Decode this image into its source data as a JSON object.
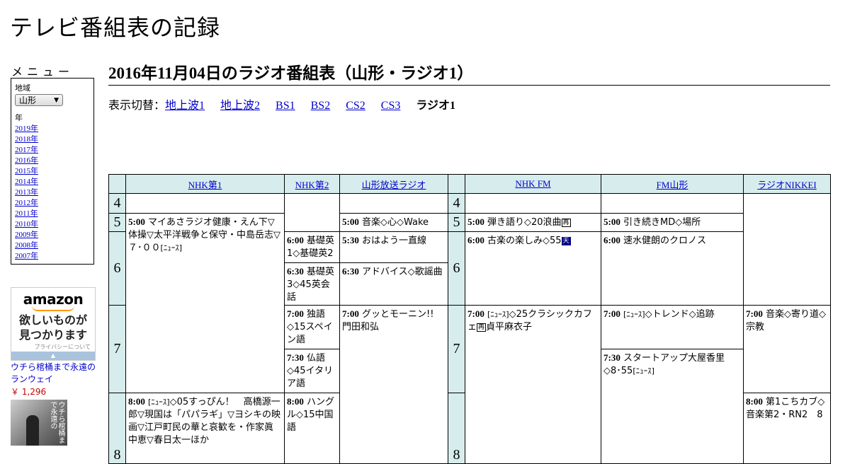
{
  "site": {
    "title": "テレビ番組表の記録"
  },
  "menu": {
    "label": "メニュー",
    "region_label": "地域",
    "region_value": "山形",
    "year_label": "年",
    "years": [
      "2019年",
      "2018年",
      "2017年",
      "2016年",
      "2015年",
      "2014年",
      "2013年",
      "2012年",
      "2011年",
      "2010年",
      "2009年",
      "2008年",
      "2007年"
    ]
  },
  "ad": {
    "logo": "amazon",
    "slogan_1": "欲しいものが",
    "slogan_2": "見つかります",
    "privacy": "プライバシーについて",
    "book_title": "ウチら棺桶まで永遠のランウェイ",
    "book_price": "￥ 1,296",
    "cover_text": "ウチら棺桶まで永遠の"
  },
  "page": {
    "title": "2016年11月04日のラジオ番組表（山形・ラジオ1）",
    "switch_label": "表示切替：",
    "switch_links": [
      "地上波1",
      "地上波2",
      "BS1",
      "BS2",
      "CS2",
      "CS3"
    ],
    "switch_current": "ラジオ1"
  },
  "schedule": {
    "channels": [
      "NHK第1",
      "NHK第2",
      "山形放送ラジオ",
      "NHK FM",
      "FM山形",
      "ラジオNIKKEI"
    ],
    "hours": [
      "4",
      "5",
      "6",
      "7",
      "8"
    ],
    "programs": {
      "nhk1_500_time": "5:00",
      "nhk1_500_text": "マイあさラジオ健康・えん下▽体操▽太平洋戦争と保守・中島岳志▽７･００",
      "nhk1_500_news": "[ﾆｭｰｽ]",
      "nhk1_800_time": "8:00",
      "nhk1_800_news": "[ﾆｭｰｽ]",
      "nhk1_800_text": "◇05すっぴん！　高橋源一郎▽現国は「パパラギ」▽ヨシキの映画▽江戸町民の華と哀歓を・作家眞中恵▽春日太一ほか",
      "nhk2_600_time": "6:00",
      "nhk2_600_text": "基礎英1◇基礎英2",
      "nhk2_630_time": "6:30",
      "nhk2_630_text": "基礎英3◇45英会話",
      "nhk2_700_time": "7:00",
      "nhk2_700_text": "独語◇15スペイン語",
      "nhk2_730_time": "7:30",
      "nhk2_730_text": "仏語◇45イタリア語",
      "nhk2_800_time": "8:00",
      "nhk2_800_text": "ハングル◇15中国語",
      "ybc_500_time": "5:00",
      "ybc_500_text": "音楽◇心◇Wake",
      "ybc_530_time": "5:30",
      "ybc_530_text": "おはよう一直線",
      "ybc_630_time": "6:30",
      "ybc_630_text": "アドバイス◇歌謡曲",
      "ybc_700_time": "7:00",
      "ybc_700_text": "グッとモーニン!!　門田和弘",
      "fm_500_time": "5:00",
      "fm_500_text": "弾き語り◇20浪曲",
      "fm_500_mark": "再",
      "fm_600_time": "6:00",
      "fm_600_text": "古楽の楽しみ◇55",
      "fm_600_mark": "天",
      "fm_700_time": "7:00",
      "fm_700_news": "[ﾆｭｰｽ]",
      "fm_700_text": "◇25クラシックカフェ",
      "fm_700_mark": "再",
      "fm_700_text2": "貞平麻衣子",
      "fmy_500_time": "5:00",
      "fmy_500_text": "引き続きMD◇場所",
      "fmy_600_time": "6:00",
      "fmy_600_text": "速水健朗のクロノス",
      "fmy_700_time": "7:00",
      "fmy_700_news": "[ﾆｭｰｽ]",
      "fmy_700_text": "◇トレンド◇追跡",
      "fmy_730_time": "7:30",
      "fmy_730_text": "スタートアップ大屋香里◇8･55",
      "fmy_730_news": "[ﾆｭｰｽ]",
      "nikkei_700_time": "7:00",
      "nikkei_700_text": "音楽◇寄り道◇宗教",
      "nikkei_800_time": "8:00",
      "nikkei_800_text": "第1こちカブ◇音楽第2・RN2　8"
    }
  }
}
